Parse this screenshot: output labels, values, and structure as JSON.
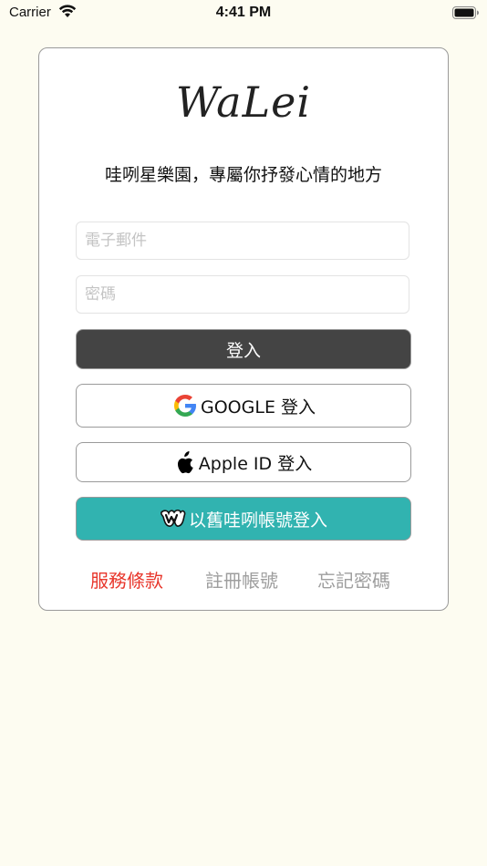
{
  "status_bar": {
    "carrier": "Carrier",
    "time": "4:41 PM",
    "wifi_icon": "wifi-icon",
    "battery_icon": "battery-icon"
  },
  "login_card": {
    "logo_text": "WaLei",
    "tagline": "哇咧星樂園，專屬你抒發心情的地方",
    "email_placeholder": "電子郵件",
    "password_placeholder": "密碼",
    "login_label": "登入",
    "google_label": "GOOGLE 登入",
    "google_icon": "google-icon",
    "apple_label": "Apple ID 登入",
    "apple_icon": "apple-icon",
    "walei_label": "以舊哇咧帳號登入",
    "walei_icon": "walei-icon",
    "colors": {
      "login_button": "#444444",
      "walei_button": "#31b3b0",
      "terms_link": "#e8362b",
      "secondary_link": "#9e9e9e",
      "background": "#fdfcf1"
    }
  },
  "footer_links": {
    "terms": "服務條款",
    "register": "註冊帳號",
    "forgot": "忘記密碼"
  }
}
